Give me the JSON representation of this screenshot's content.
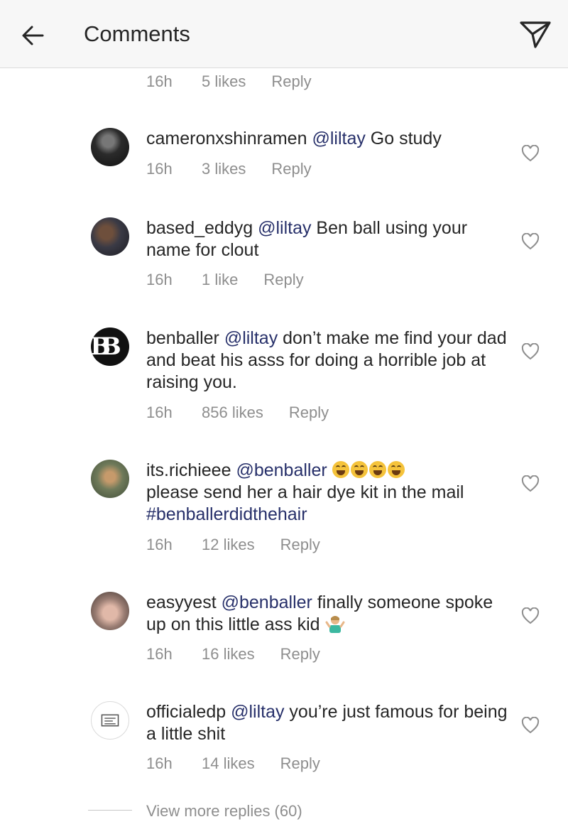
{
  "header": {
    "title": "Comments",
    "back_icon": "arrow-left-icon",
    "send_icon": "paper-plane-icon"
  },
  "top_meta": {
    "time": "16h",
    "likes": "5 likes",
    "reply": "Reply"
  },
  "comments": [
    {
      "username": "cameronxshinramen",
      "mention": "@liltay",
      "text": " Go study",
      "time": "16h",
      "likes": "3 likes",
      "reply": "Reply"
    },
    {
      "username": "based_eddyg",
      "mention": "@liltay",
      "text": " Ben ball using your name for clout",
      "time": "16h",
      "likes": "1 like",
      "reply": "Reply"
    },
    {
      "username": "benballer",
      "mention": "@liltay",
      "text": " don’t make me find your dad and beat his asss for doing a horrible job at raising you.",
      "time": "16h",
      "likes": "856 likes",
      "reply": "Reply",
      "avatar_glyph": "B"
    },
    {
      "username": "its.richieee",
      "mention": "@benballer",
      "text": "please send her a hair dye kit in the mail",
      "hashtag": "#benballerdidthehair",
      "time": "16h",
      "likes": "12 likes",
      "reply": "Reply"
    },
    {
      "username": "easyyest",
      "mention": "@benballer",
      "text": " finally someone spoke up on this little ass kid",
      "time": "16h",
      "likes": "16 likes",
      "reply": "Reply"
    },
    {
      "username": "officialedp",
      "mention": "@liltay",
      "text": " you’re just famous for being a little shit",
      "time": "16h",
      "likes": "14 likes",
      "reply": "Reply"
    }
  ],
  "view_more_replies": "View more replies (60)",
  "colors": {
    "mention": "#27306a",
    "muted": "#8e8e8e",
    "text": "#262626",
    "header_bg": "#f7f7f7"
  }
}
